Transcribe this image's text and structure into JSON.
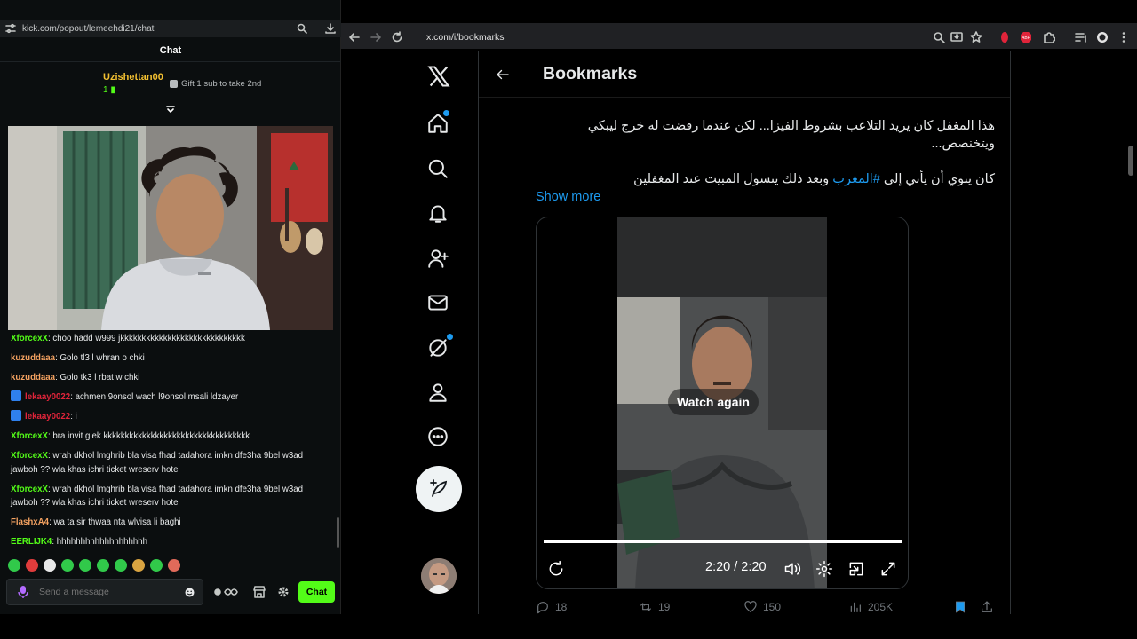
{
  "kick": {
    "url": "kick.com/popout/lemeehdi21/chat",
    "chat_title": "Chat",
    "leader": {
      "rank": "1",
      "username": "Uzishettan00",
      "count": "1",
      "gift_text": "Gift 1 sub to take 2nd"
    },
    "messages": [
      {
        "user": "XforcexX",
        "color": "#53fc18",
        "badge": false,
        "text": ": choo hadd w999 jkkkkkkkkkkkkkkkkkkkkkkkkkkkkk"
      },
      {
        "user": "kuzuddaaa",
        "color": "#f4a261",
        "badge": false,
        "text": ": Golo tl3 l whran o chki"
      },
      {
        "user": "kuzuddaaa",
        "color": "#f4a261",
        "badge": false,
        "text": ": Golo tk3 l rbat w chki"
      },
      {
        "user": "lekaay0022",
        "color": "#e0243a",
        "badge": true,
        "text": ": achmen 9onsol wach l9onsol msali ldzayer"
      },
      {
        "user": "lekaay0022",
        "color": "#e0243a",
        "badge": true,
        "text": ": i"
      },
      {
        "user": "XforcexX",
        "color": "#53fc18",
        "badge": false,
        "text": ": bra invit glek kkkkkkkkkkkkkkkkkkkkkkkkkkkkkkkkkk"
      },
      {
        "user": "XforcexX",
        "color": "#53fc18",
        "badge": false,
        "text": ": wrah dkhol lmghrib bla visa fhad tadahora imkn dfe3ha 9bel w3ad jawboh ?? wla khas ichri ticket wreserv hotel"
      },
      {
        "user": "XforcexX",
        "color": "#53fc18",
        "badge": false,
        "text": ": wrah dkhol lmghrib bla visa fhad tadahora imkn dfe3ha 9bel w3ad jawboh ?? wla khas ichri ticket wreserv hotel"
      },
      {
        "user": "FlashxA4",
        "color": "#f4a261",
        "badge": false,
        "text": ": wa ta sir thwaa nta wlvisa li baghi"
      },
      {
        "user": "EERLIJK4",
        "color": "#53fc18",
        "badge": false,
        "text": ": hhhhhhhhhhhhhhhhhhh"
      }
    ],
    "input_placeholder": "Send a message",
    "chat_button": "Chat"
  },
  "browser": {
    "url": "x.com/i/bookmarks"
  },
  "x": {
    "page_title": "Bookmarks",
    "tweet_line1": "هذا المغفل كان يريد التلاعب بشروط الفيزا... لكن عندما رفضت له خرج ليبكي ويتخنصص...",
    "tweet_line2_pre": "كان ينوي أن يأتي إلى ",
    "tweet_hashtag": "#المغرب",
    "tweet_line2_post": " وبعد ذلك يتسول المبيت عند المغفلين",
    "show_more": "Show more",
    "watch_again": "Watch again",
    "video_time": "2:20 / 2:20",
    "video_progress": 1.0,
    "replies": "18",
    "reposts": "19",
    "likes": "150",
    "views": "205K"
  }
}
